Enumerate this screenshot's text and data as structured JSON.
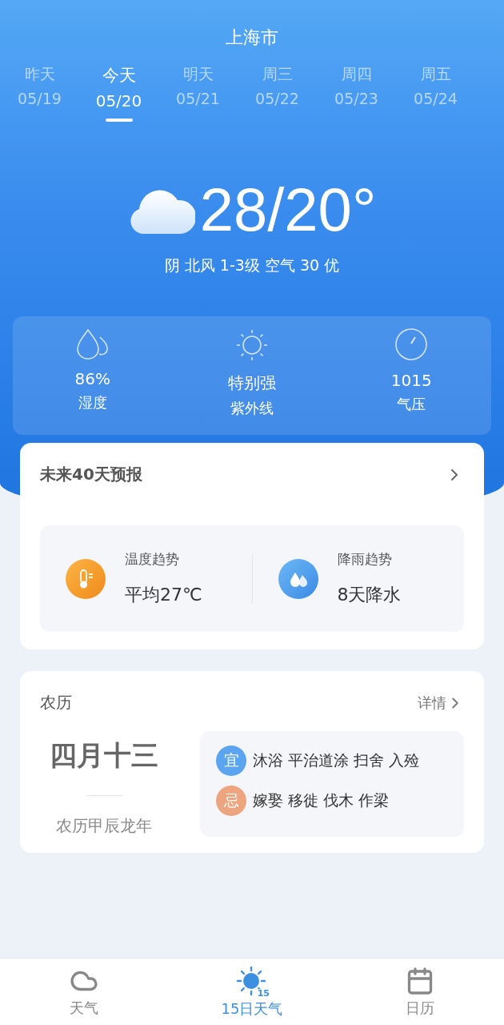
{
  "city": "上海市",
  "days": [
    {
      "day": "昨天",
      "date": "05/19",
      "selected": false
    },
    {
      "day": "今天",
      "date": "05/20",
      "selected": true
    },
    {
      "day": "明天",
      "date": "05/21",
      "selected": false
    },
    {
      "day": "周三",
      "date": "05/22",
      "selected": false
    },
    {
      "day": "周四",
      "date": "05/23",
      "selected": false
    },
    {
      "day": "周五",
      "date": "05/24",
      "selected": false
    }
  ],
  "current": {
    "temperature": "28/20°",
    "summary": "阴 北风 1-3级 空气 30 优"
  },
  "stats": [
    {
      "kind": "humidity",
      "value": "86%",
      "label": "湿度"
    },
    {
      "kind": "uv",
      "value": "特别强",
      "label": "紫外线"
    },
    {
      "kind": "pressure",
      "value": "1015",
      "label": "气压"
    }
  ],
  "forecast40": {
    "title": "未来40天预报",
    "trends": [
      {
        "kind": "temperature",
        "label": "温度趋势",
        "value": "平均27℃"
      },
      {
        "kind": "rain",
        "label": "降雨趋势",
        "value": "8天降水"
      }
    ]
  },
  "lunar": {
    "title": "农历",
    "link": "详情",
    "date": "四月十三",
    "year": "农历甲辰龙年",
    "rows": [
      {
        "tag": "宜",
        "color": "#5ba4ef",
        "items": "沐浴 平治道涂 扫舍 入殓"
      },
      {
        "tag": "忌",
        "color": "#eda57f",
        "items": "嫁娶 移徙 伐木 作梁"
      }
    ]
  },
  "nav": [
    {
      "kind": "weather",
      "label": "天气",
      "selected": false
    },
    {
      "kind": "fifteen",
      "label": "15日天气",
      "badge": "15",
      "selected": true
    },
    {
      "kind": "calendar",
      "label": "日历",
      "selected": false
    }
  ]
}
